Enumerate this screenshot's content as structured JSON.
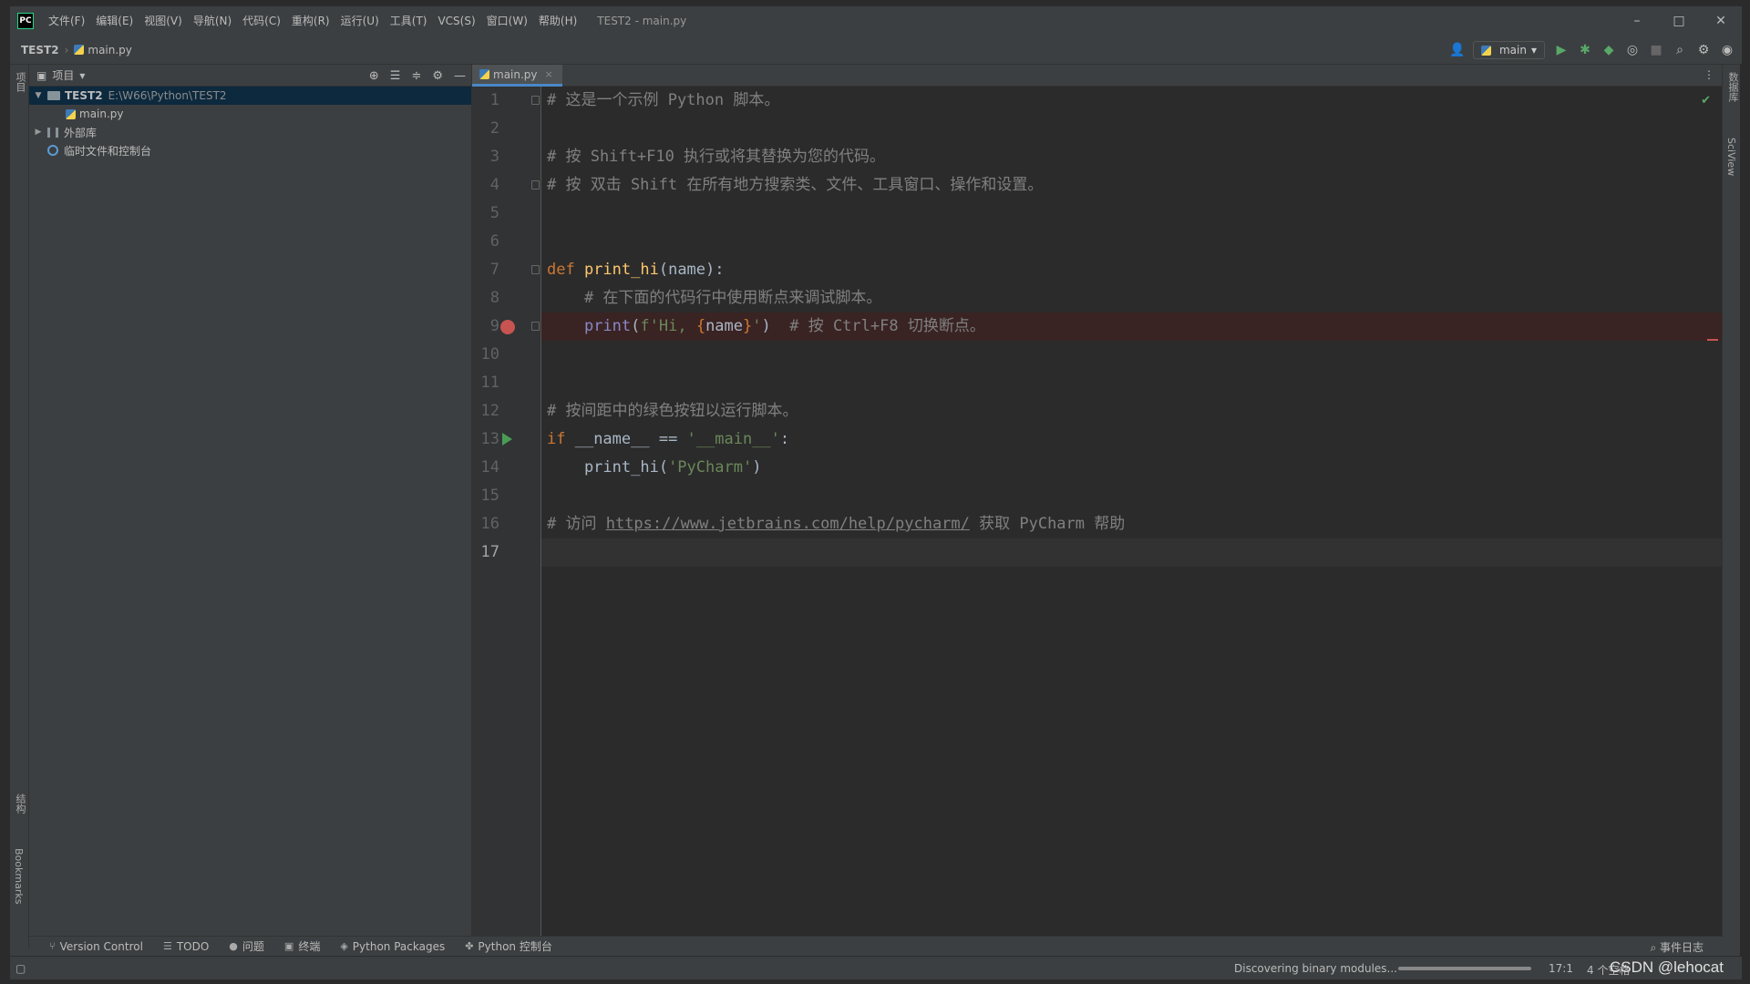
{
  "window": {
    "title": "TEST2 - main.py",
    "app_icon": "PC",
    "controls": [
      "–",
      "□",
      "✕"
    ]
  },
  "menu": [
    "文件(F)",
    "编辑(E)",
    "视图(V)",
    "导航(N)",
    "代码(C)",
    "重构(R)",
    "运行(U)",
    "工具(T)",
    "VCS(S)",
    "窗口(W)",
    "帮助(H)"
  ],
  "navbar": {
    "project": "TEST2",
    "file": "main.py",
    "run_config": "main"
  },
  "left_strip": {
    "project_label": "项目",
    "structure_label": "结构",
    "bookmarks_label": "Bookmarks"
  },
  "right_strip": {
    "database_label": "数据库",
    "sciview_label": "SciView"
  },
  "project_panel": {
    "title": "项目",
    "tree": [
      {
        "label": "TEST2",
        "path": "E:\\W66\\Python\\TEST2",
        "type": "folder",
        "expanded": true,
        "selected": true
      },
      {
        "label": "main.py",
        "type": "python-file"
      },
      {
        "label": "外部库",
        "type": "library",
        "expanded": false
      },
      {
        "label": "临时文件和控制台",
        "type": "scratch"
      }
    ]
  },
  "editor": {
    "tab": {
      "label": "main.py",
      "close": "×"
    },
    "current_line": 17,
    "breakpoint_line": 9,
    "run_gutter_line": 13,
    "lines": [
      {
        "n": "1",
        "tokens": [
          {
            "t": "# 这是一个示例 Python 脚本。",
            "c": "cm"
          }
        ]
      },
      {
        "n": "2",
        "tokens": []
      },
      {
        "n": "3",
        "tokens": [
          {
            "t": "# 按 Shift+F10 执行或将其替换为您的代码。",
            "c": "cm"
          }
        ]
      },
      {
        "n": "4",
        "tokens": [
          {
            "t": "# 按 双击 Shift 在所有地方搜索类、文件、工具窗口、操作和设置。",
            "c": "cm"
          }
        ]
      },
      {
        "n": "5",
        "tokens": []
      },
      {
        "n": "6",
        "tokens": []
      },
      {
        "n": "7",
        "tokens": [
          {
            "t": "def ",
            "c": "kw"
          },
          {
            "t": "print_hi",
            "c": "fn"
          },
          {
            "t": "(name):",
            "c": ""
          }
        ]
      },
      {
        "n": "8",
        "tokens": [
          {
            "t": "    # 在下面的代码行中使用断点来调试脚本。",
            "c": "cm"
          }
        ]
      },
      {
        "n": "9",
        "tokens": [
          {
            "t": "    ",
            "c": ""
          },
          {
            "t": "print",
            "c": "bi"
          },
          {
            "t": "(",
            "c": ""
          },
          {
            "t": "f'Hi, ",
            "c": "str"
          },
          {
            "t": "{",
            "c": "kw"
          },
          {
            "t": "name",
            "c": ""
          },
          {
            "t": "}",
            "c": "kw"
          },
          {
            "t": "'",
            "c": "str"
          },
          {
            "t": ")  ",
            "c": ""
          },
          {
            "t": "# 按 Ctrl+F8 切换断点。",
            "c": "cm"
          }
        ]
      },
      {
        "n": "10",
        "tokens": []
      },
      {
        "n": "11",
        "tokens": []
      },
      {
        "n": "12",
        "tokens": [
          {
            "t": "# 按间距中的绿色按钮以运行脚本。",
            "c": "cm"
          }
        ]
      },
      {
        "n": "13",
        "tokens": [
          {
            "t": "if ",
            "c": "kw"
          },
          {
            "t": "__name__ == ",
            "c": ""
          },
          {
            "t": "'__main__'",
            "c": "str"
          },
          {
            "t": ":",
            "c": ""
          }
        ]
      },
      {
        "n": "14",
        "tokens": [
          {
            "t": "    print_hi(",
            "c": ""
          },
          {
            "t": "'PyCharm'",
            "c": "str"
          },
          {
            "t": ")",
            "c": ""
          }
        ]
      },
      {
        "n": "15",
        "tokens": []
      },
      {
        "n": "16",
        "tokens": [
          {
            "t": "# 访问 ",
            "c": "cm"
          },
          {
            "t": "https://www.jetbrains.com/help/pycharm/",
            "c": "link"
          },
          {
            "t": " 获取 PyCharm 帮助",
            "c": "cm"
          }
        ]
      },
      {
        "n": "17",
        "tokens": []
      }
    ]
  },
  "bottom_tabs": [
    {
      "label": "Version Control",
      "icon": "branch-icon"
    },
    {
      "label": "TODO",
      "icon": "list-icon"
    },
    {
      "label": "问题",
      "icon": "info-icon"
    },
    {
      "label": "终端",
      "icon": "terminal-icon"
    },
    {
      "label": "Python Packages",
      "icon": "package-icon"
    },
    {
      "label": "Python 控制台",
      "icon": "python-console-icon"
    }
  ],
  "event_log": "事件日志",
  "status": {
    "message": "Discovering binary modules...",
    "progress": 1.0,
    "position": "17:1",
    "indent": "4 个空格",
    "watermark": "CSDN @lehocat"
  },
  "colors": {
    "background": "#2b2b2b",
    "panel": "#3c3f41",
    "keyword": "#cc7832",
    "function": "#ffc66d",
    "string": "#6a8759",
    "comment": "#808080",
    "breakpoint": "#c75450",
    "run": "#499c54"
  }
}
